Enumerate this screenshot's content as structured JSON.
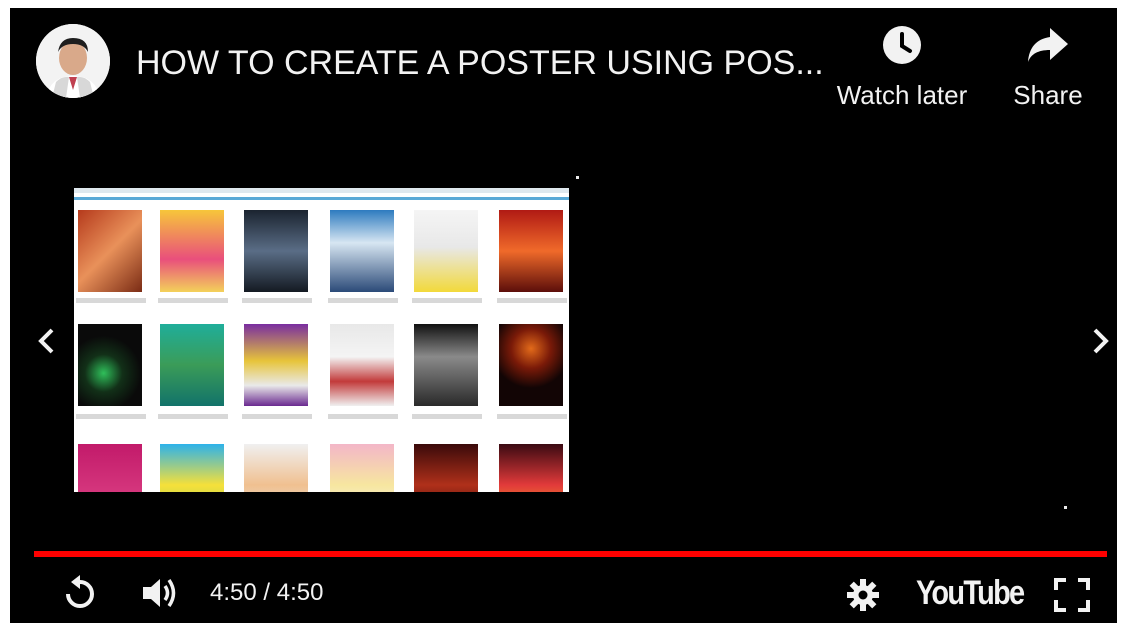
{
  "header": {
    "title": "HOW TO CREATE A POSTER USING POS...",
    "watch_later_label": "Watch later",
    "share_label": "Share"
  },
  "controls": {
    "time_display": "4:50 / 4:50",
    "logo_text": "YouTube",
    "progress": 1.0
  },
  "colors": {
    "progress": "#ff0000",
    "background": "#000000",
    "text": "#f2f2f2"
  },
  "icons": {
    "watch_later": "clock-icon",
    "share": "share-arrow-icon",
    "prev": "chevron-left-icon",
    "next": "chevron-right-icon",
    "replay": "replay-icon",
    "volume": "volume-icon",
    "settings": "gear-icon",
    "fullscreen": "fullscreen-icon"
  }
}
